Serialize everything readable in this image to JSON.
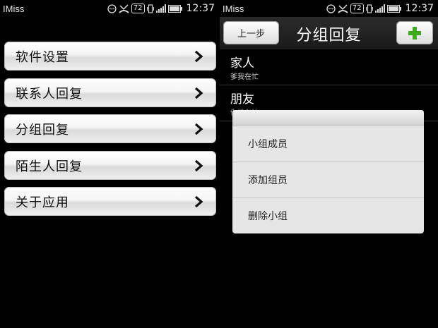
{
  "status": {
    "app_name": "IMiss",
    "battery": "72",
    "time": "12:37"
  },
  "left": {
    "menu": [
      {
        "label": "软件设置"
      },
      {
        "label": "联系人回复"
      },
      {
        "label": "分组回复"
      },
      {
        "label": "陌生人回复"
      },
      {
        "label": "关于应用"
      }
    ]
  },
  "right": {
    "back_label": "上一步",
    "title": "分组回复",
    "groups": [
      {
        "name": "家人",
        "status": "爹我在忙"
      },
      {
        "name": "朋友",
        "status": "你说在忙"
      }
    ],
    "context_menu": [
      {
        "label": "小组成员"
      },
      {
        "label": "添加组员"
      },
      {
        "label": "删除小组"
      }
    ]
  },
  "colors": {
    "accent_plus": "#3faa1d",
    "background": "#000000",
    "button_face": "#f2f2f2"
  }
}
